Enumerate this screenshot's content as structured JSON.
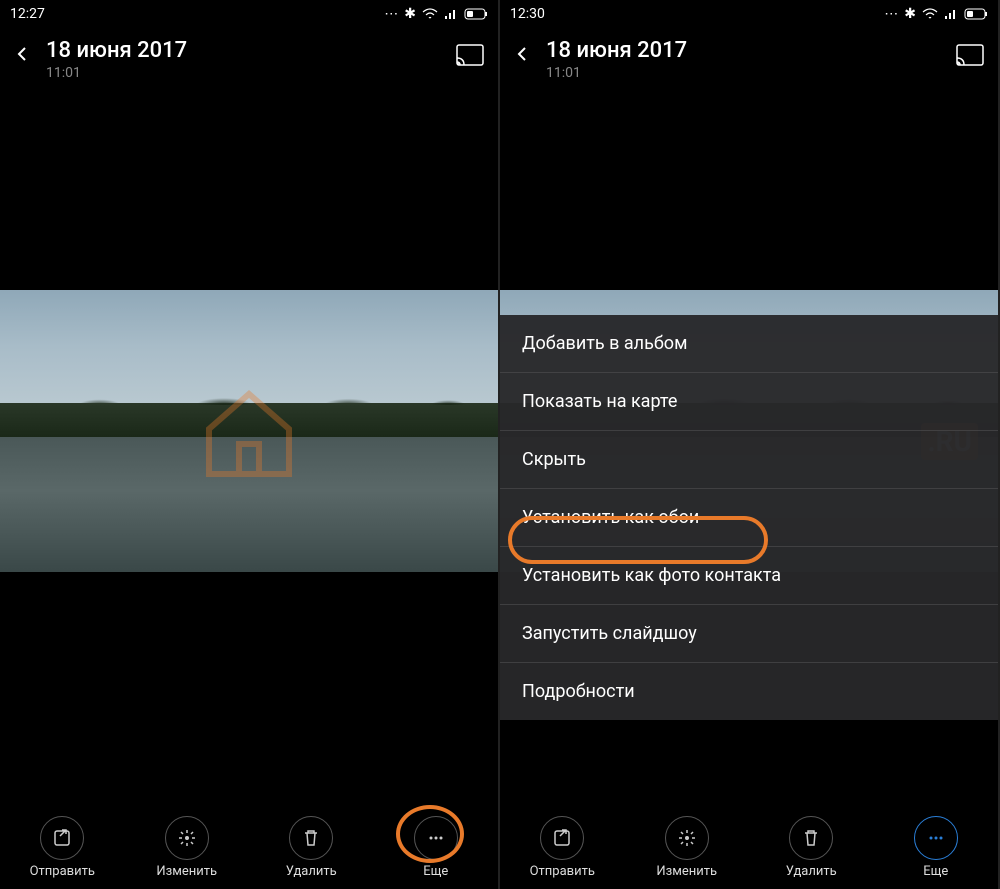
{
  "left": {
    "statusbar": {
      "time": "12:27"
    },
    "header": {
      "date": "18 июня 2017",
      "time": "11:01"
    },
    "buttons": {
      "share": "Отправить",
      "edit": "Изменить",
      "delete": "Удалить",
      "more": "Еще"
    }
  },
  "right": {
    "statusbar": {
      "time": "12:30"
    },
    "header": {
      "date": "18 июня 2017",
      "time": "11:01"
    },
    "menu": {
      "add_album": "Добавить в альбом",
      "show_map": "Показать на карте",
      "hide": "Скрыть",
      "set_wallpaper": "Установить как обои",
      "set_contact": "Установить как фото контакта",
      "slideshow": "Запустить слайдшоу",
      "details": "Подробности"
    },
    "buttons": {
      "share": "Отправить",
      "edit": "Изменить",
      "delete": "Удалить",
      "more": "Еще"
    }
  },
  "watermark": ".RU"
}
